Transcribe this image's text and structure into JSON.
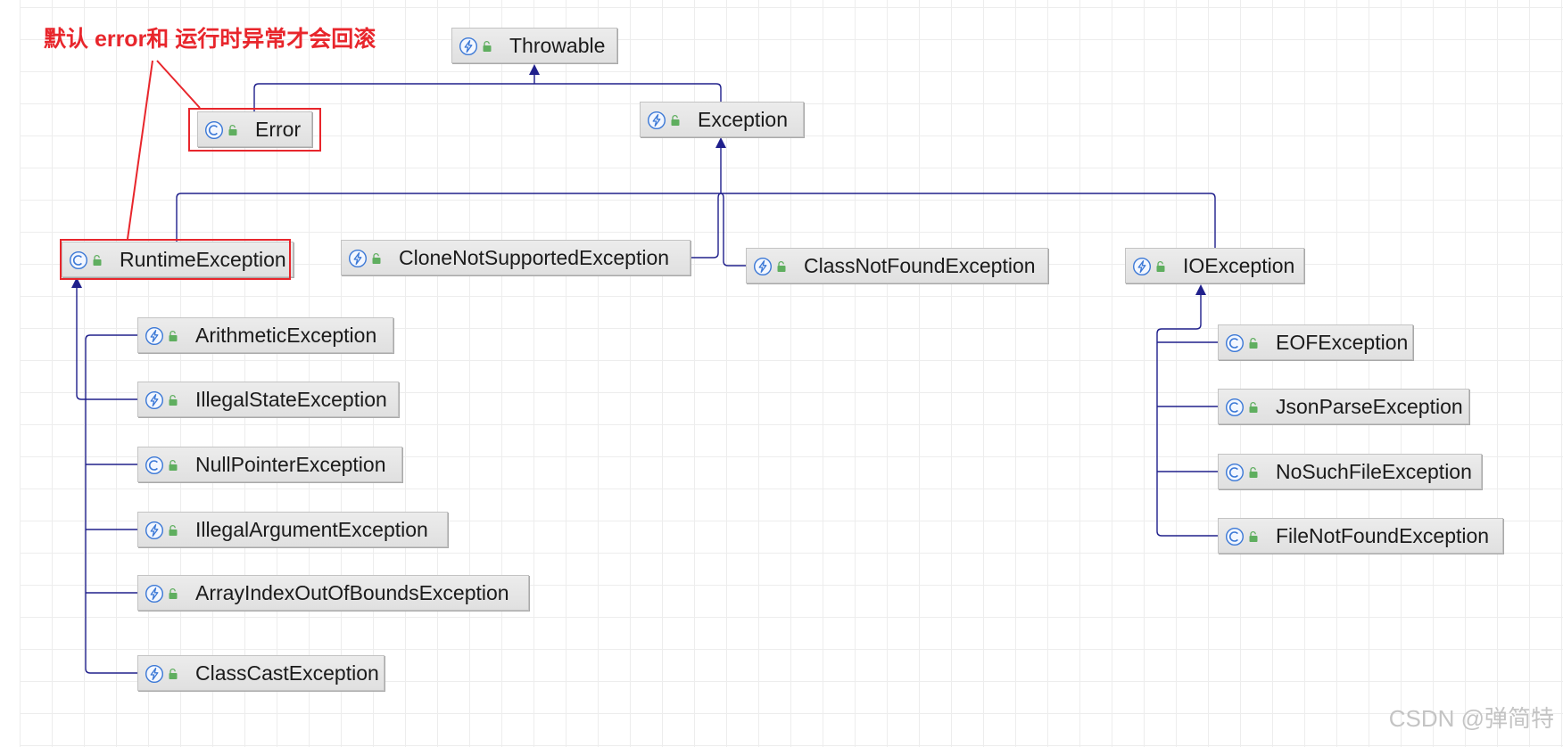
{
  "annotation": {
    "text": "默认 error和 运行时异常才会回滚"
  },
  "watermark": "CSDN @弹简特",
  "colors": {
    "connector": "#20208c",
    "highlight": "#e8262c",
    "icon": "#3b78d6",
    "lock": "#5fae5f"
  },
  "lock_icon": "lock-icon",
  "nodes": {
    "throwable": {
      "label": "Throwable",
      "icon": "lightning-circle-icon"
    },
    "error": {
      "label": "Error",
      "icon": "class-c-icon"
    },
    "exception": {
      "label": "Exception",
      "icon": "lightning-circle-icon"
    },
    "runtime_exception": {
      "label": "RuntimeException",
      "icon": "class-c-icon"
    },
    "clone_not_supported_exception": {
      "label": "CloneNotSupportedException",
      "icon": "lightning-circle-icon"
    },
    "class_not_found_exception": {
      "label": "ClassNotFoundException",
      "icon": "lightning-circle-icon"
    },
    "io_exception": {
      "label": "IOException",
      "icon": "lightning-circle-icon"
    },
    "arithmetic_exception": {
      "label": "ArithmeticException",
      "icon": "lightning-circle-icon"
    },
    "illegal_state_exception": {
      "label": "IllegalStateException",
      "icon": "lightning-circle-icon"
    },
    "null_pointer_exception": {
      "label": "NullPointerException",
      "icon": "class-c-icon"
    },
    "illegal_argument_exception": {
      "label": "IllegalArgumentException",
      "icon": "lightning-circle-icon"
    },
    "array_index_out_of_bounds_exception": {
      "label": "ArrayIndexOutOfBoundsException",
      "icon": "lightning-circle-icon"
    },
    "class_cast_exception": {
      "label": "ClassCastException",
      "icon": "lightning-circle-icon"
    },
    "eof_exception": {
      "label": "EOFException",
      "icon": "class-c-icon"
    },
    "json_parse_exception": {
      "label": "JsonParseException",
      "icon": "class-c-icon"
    },
    "no_such_file_exception": {
      "label": "NoSuchFileException",
      "icon": "class-c-icon"
    },
    "file_not_found_exception": {
      "label": "FileNotFoundException",
      "icon": "class-c-icon"
    }
  }
}
